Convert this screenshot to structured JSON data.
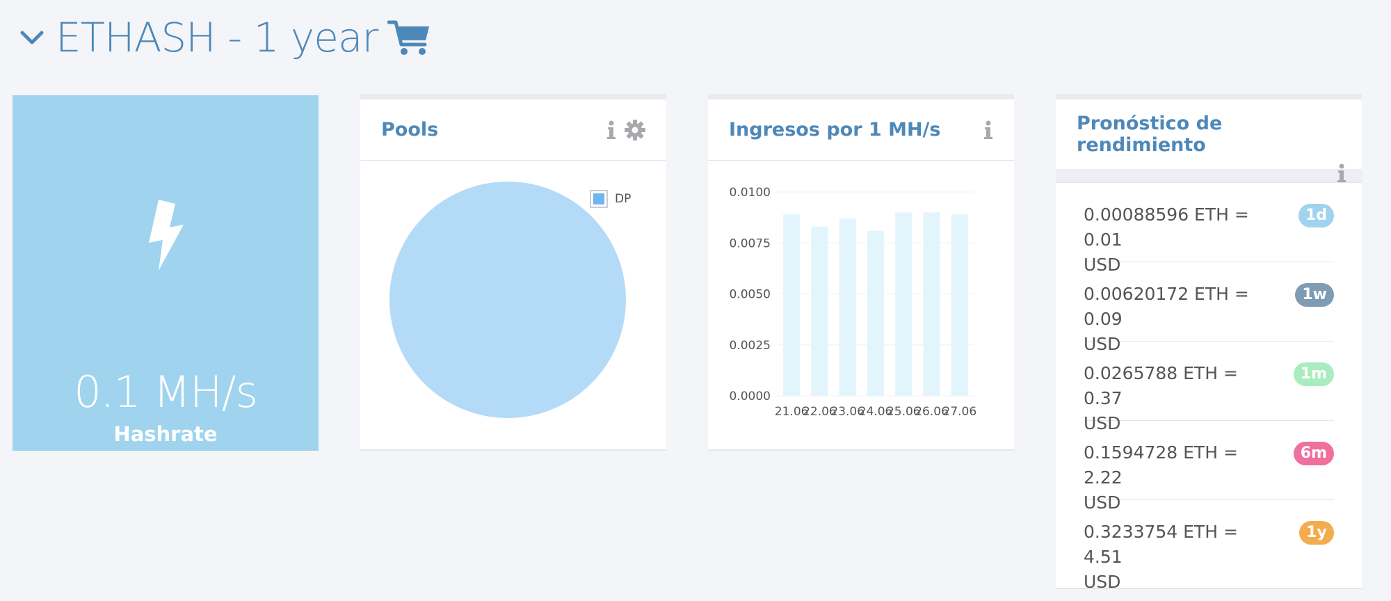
{
  "header": {
    "title": "ETHASH - 1 year",
    "accent": "#4e88b9"
  },
  "hashrate": {
    "value": "0.1 MH/s",
    "label": "Hashrate",
    "bg": "#9fd3ee"
  },
  "pools": {
    "title": "Pools",
    "legend": [
      {
        "label": "DP",
        "color": "#6fb5ee"
      }
    ],
    "slices": [
      {
        "label": "DP",
        "value": 100,
        "color": "#b3dbf8"
      }
    ]
  },
  "income": {
    "title": "Ingresos por 1 MH/s"
  },
  "chart_data": {
    "type": "bar",
    "title": "Ingresos por 1 MH/s",
    "categories": [
      "21.06",
      "22.06",
      "23.06",
      "24.06",
      "25.06",
      "26.06",
      "27.06"
    ],
    "values": [
      0.0089,
      0.0083,
      0.0087,
      0.0081,
      0.009,
      0.009,
      0.0089
    ],
    "yticks": [
      "0.0000",
      "0.0025",
      "0.0050",
      "0.0075",
      "0.0100"
    ],
    "ylim": [
      0,
      0.01
    ],
    "grid": true,
    "bar_color": "#e3f5fc"
  },
  "forecast": {
    "title": "Pronóstico de rendimiento",
    "items": [
      {
        "line1": "0.00088596 ETH = 0.01",
        "line2": "USD",
        "badge": "1d",
        "color": "#9fd3ee"
      },
      {
        "line1": "0.00620172 ETH = 0.09",
        "line2": "USD",
        "badge": "1w",
        "color": "#7e9cb4"
      },
      {
        "line1": "0.0265788 ETH = 0.37",
        "line2": "USD",
        "badge": "1m",
        "color": "#a9ecc0"
      },
      {
        "line1": "0.1594728 ETH = 2.22",
        "line2": "USD",
        "badge": "6m",
        "color": "#ef6f9d"
      },
      {
        "line1": "0.3233754 ETH = 4.51",
        "line2": "USD",
        "badge": "1y",
        "color": "#f4ac4f"
      }
    ]
  }
}
